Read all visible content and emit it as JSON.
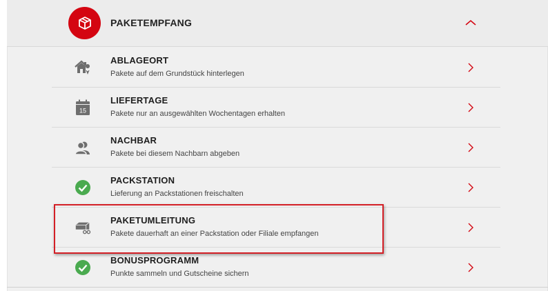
{
  "header": {
    "title": "PAKETEMPFANG",
    "icon": "package-icon",
    "toggle_icon": "chevron-up-icon",
    "accent_color": "#d40511"
  },
  "items": [
    {
      "title": "ABLAGEORT",
      "subtitle": "Pakete auf dem Grundstück hinterlegen",
      "icon": "house-location-icon"
    },
    {
      "title": "LIEFERTAGE",
      "subtitle": "Pakete nur an ausgewählten Wochentagen erhalten",
      "icon": "calendar-icon",
      "icon_text": "15"
    },
    {
      "title": "NACHBAR",
      "subtitle": "Pakete bei diesem Nachbarn abgeben",
      "icon": "neighbor-icon"
    },
    {
      "title": "PACKSTATION",
      "subtitle": "Lieferung an Packstationen freischalten",
      "icon": "check-circle-icon"
    },
    {
      "title": "PAKETUMLEITUNG",
      "subtitle": "Pakete dauerhaft an einer Packstation oder Filiale empfangen",
      "icon": "package-redirect-icon"
    },
    {
      "title": "BONUSPROGRAMM",
      "subtitle": "Punkte sammeln und Gutscheine sichern",
      "icon": "check-circle-icon"
    }
  ],
  "colors": {
    "chevron": "#d40511",
    "check": "#4aaa4f",
    "highlight_border": "#d31e25",
    "icon_gray": "#6e6e6e"
  }
}
